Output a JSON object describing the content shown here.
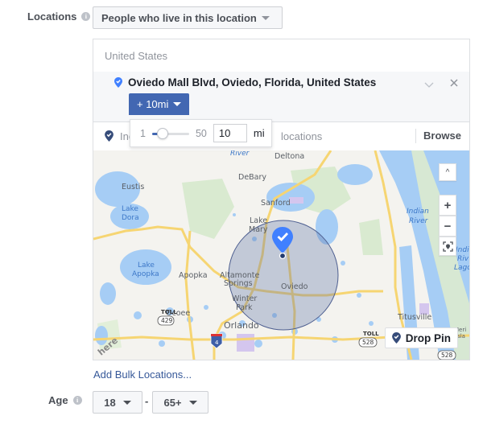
{
  "locations": {
    "label": "Locations",
    "info_icon": "info-icon",
    "type_select": "People who live in this location",
    "country": "United States",
    "selected_location": {
      "name": "Oviedo Mall Blvd, Oviedo, Florida, United States",
      "icon": "location-pin-icon",
      "radius_button": "+ 10mi"
    },
    "radius_popup": {
      "min_label": "1",
      "max_label": "50",
      "value": "10",
      "unit": "mi",
      "slider_min": 1,
      "slider_max": 50,
      "slider_value": 10
    },
    "search": {
      "prefix": "Inc",
      "suffix": "locations",
      "placeholder_hint": "Include more locations",
      "browse_label": "Browse"
    },
    "map": {
      "place_labels": [
        "Deltona",
        "DeBary",
        "Eustis",
        "Sanford",
        "Lake",
        "Mary",
        "Apopka",
        "Altamonte",
        "Springs",
        "Oviedo",
        "Winter",
        "Park",
        "Ocoee",
        "Orlando",
        "Titusville",
        "Meri",
        "Isla"
      ],
      "water_labels": [
        "Lake",
        "Dora",
        "Lake",
        "Apopka",
        "Indian",
        "River",
        "Indi",
        "Riv",
        "Lago",
        "River"
      ],
      "road_shields": [
        "TOLL",
        "429",
        "4",
        "TOLL",
        "528",
        "528"
      ],
      "watermark": "here",
      "controls": {
        "collapse": "^",
        "zoom_in": "+",
        "zoom_out": "−"
      },
      "drop_pin_label": "Drop Pin"
    },
    "bulk_link": "Add Bulk Locations..."
  },
  "age": {
    "label": "Age",
    "min": "18",
    "separator": "-",
    "max": "65+"
  },
  "colors": {
    "accent": "#4267b2",
    "link": "#365899",
    "radius_circle": "#5b6fa6"
  }
}
